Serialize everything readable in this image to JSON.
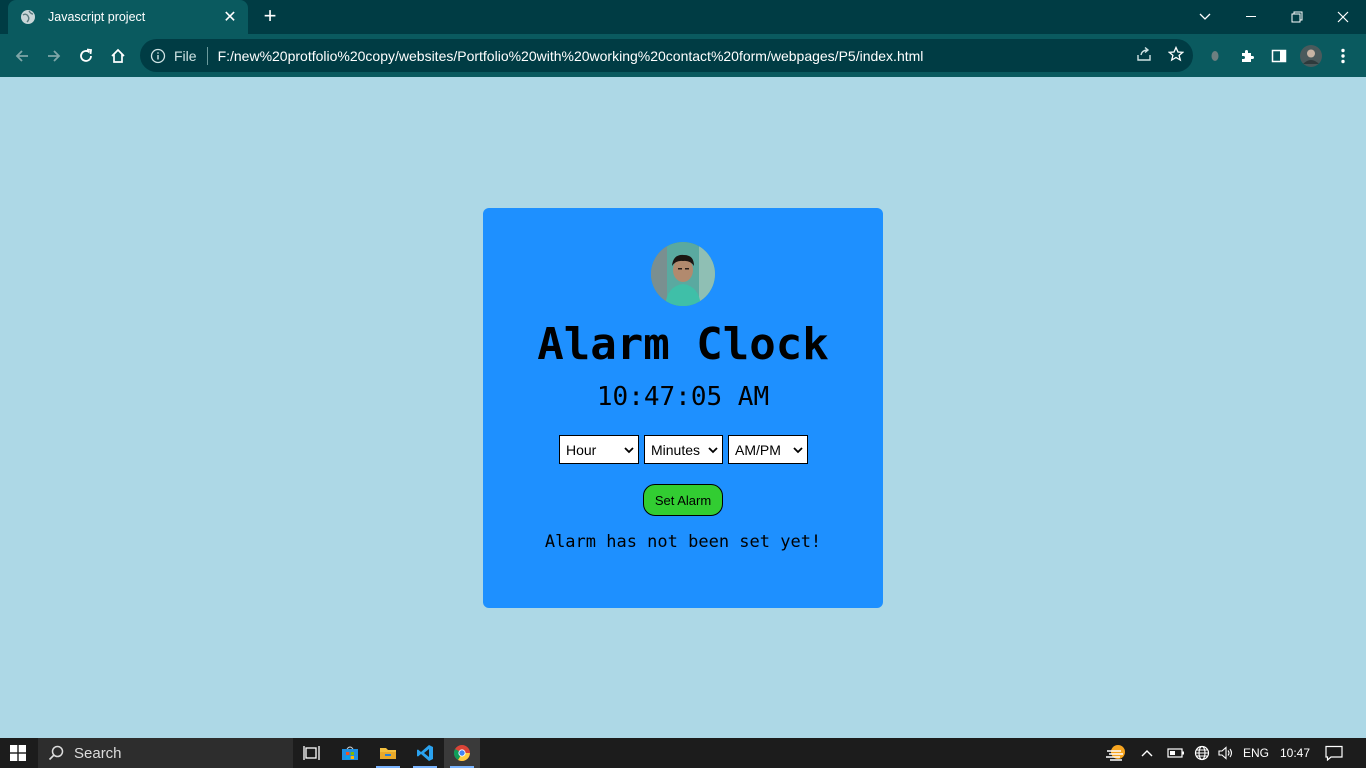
{
  "browser": {
    "tab_title": "Javascript project",
    "tab_close": "✕",
    "new_tab": "+",
    "file_label": "File",
    "url": "F:/new%20protfolio%20copy/websites/Portfolio%20with%20working%20contact%20form/webpages/P5/index.html"
  },
  "page": {
    "title": "Alarm Clock",
    "time": "10:47:05 AM",
    "selects": [
      {
        "label": "Hour"
      },
      {
        "label": "Minutes"
      },
      {
        "label": "AM/PM"
      }
    ],
    "set_button": "Set Alarm",
    "status": "Alarm has not been set yet!",
    "colors": {
      "background": "#add8e6",
      "card": "#1e90ff",
      "button": "#32cd32"
    }
  },
  "taskbar": {
    "search_placeholder": "Search",
    "language": "ENG",
    "clock": "10:47"
  }
}
